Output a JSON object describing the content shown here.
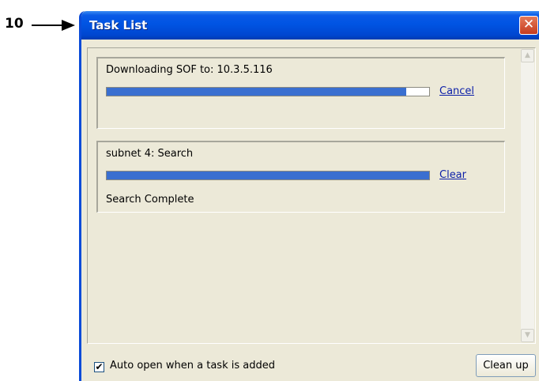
{
  "callout": {
    "number": "10"
  },
  "window": {
    "title": "Task List",
    "close_glyph": "✕"
  },
  "tasks": [
    {
      "title": "Downloading SOF to: 10.3.5.116",
      "progress": 0.93,
      "action": "Cancel",
      "status": ""
    },
    {
      "title": "subnet 4: Search",
      "progress": 1.0,
      "action": "Clear",
      "status": "Search Complete"
    }
  ],
  "footer": {
    "auto_open_checked": true,
    "auto_open_label": "Auto open when a task is added",
    "cleanup_label": "Clean up"
  },
  "colors": {
    "progress_fill": "#3a6fd0",
    "link": "#0b1ea8",
    "titlebar": "#0054e3"
  }
}
